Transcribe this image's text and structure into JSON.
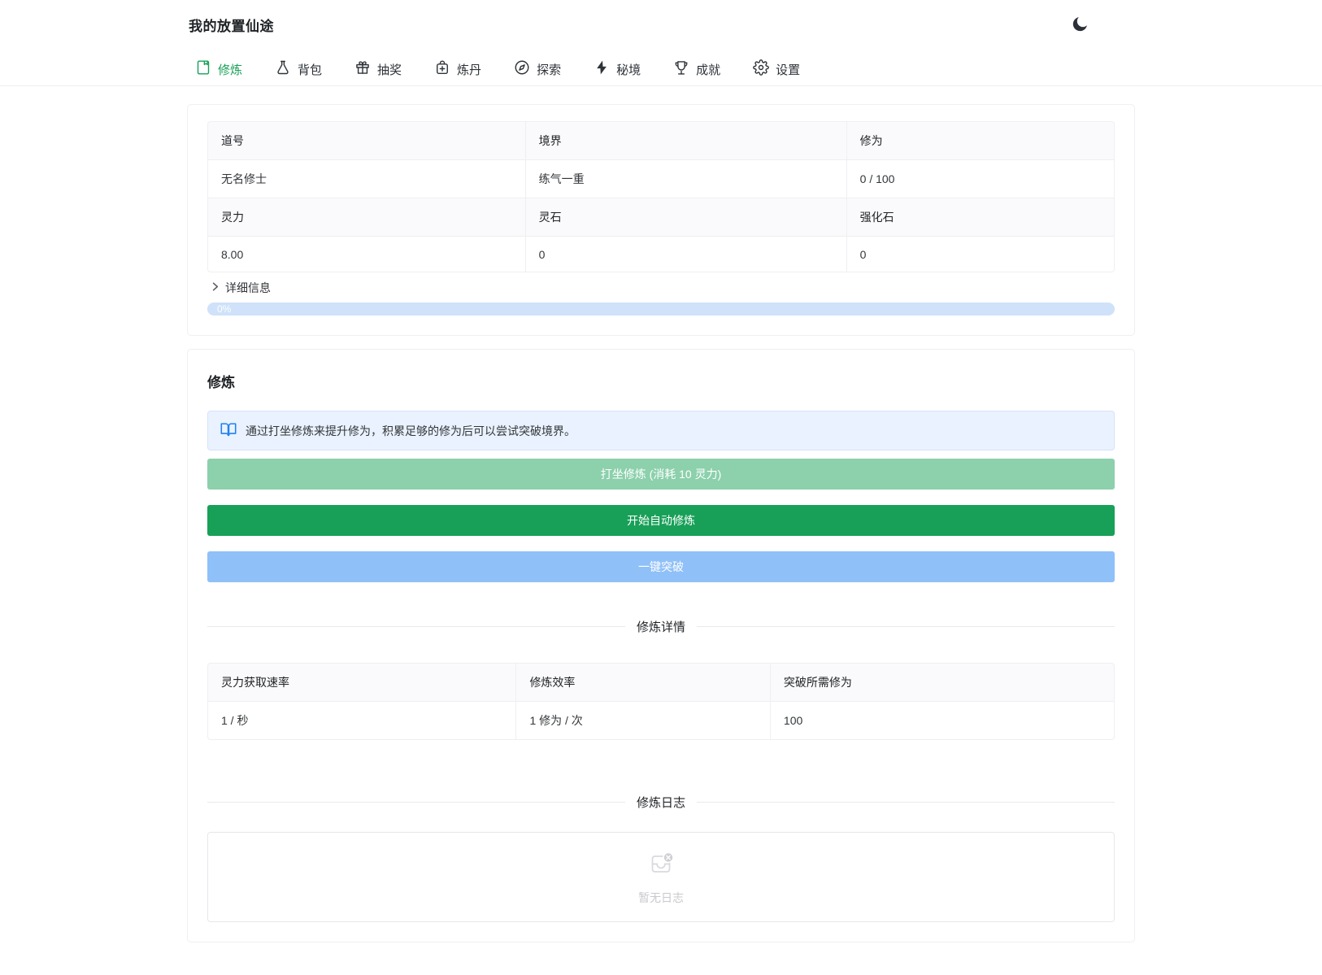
{
  "app": {
    "title": "我的放置仙途"
  },
  "nav": {
    "tabs": [
      {
        "label": "修炼",
        "icon": "journal-icon",
        "active": true
      },
      {
        "label": "背包",
        "icon": "flask-icon",
        "active": false
      },
      {
        "label": "抽奖",
        "icon": "gift-icon",
        "active": false
      },
      {
        "label": "炼丹",
        "icon": "medicine-bag-icon",
        "active": false
      },
      {
        "label": "探索",
        "icon": "compass-icon",
        "active": false
      },
      {
        "label": "秘境",
        "icon": "lightning-icon",
        "active": false
      },
      {
        "label": "成就",
        "icon": "trophy-icon",
        "active": false
      },
      {
        "label": "设置",
        "icon": "gear-icon",
        "active": false
      }
    ],
    "theme_toggle_icon": "moon-icon"
  },
  "stats_card": {
    "table": {
      "rows": [
        {
          "header": true,
          "cells": [
            "道号",
            "境界",
            "修为"
          ]
        },
        {
          "header": false,
          "cells": [
            "无名修士",
            "练气一重",
            "0 / 100"
          ]
        },
        {
          "header": true,
          "cells": [
            "灵力",
            "灵石",
            "强化石"
          ]
        },
        {
          "header": false,
          "cells": [
            "8.00",
            "0",
            "0"
          ]
        }
      ]
    },
    "details_toggle_label": "详细信息",
    "progress": {
      "label": "0%",
      "percent": 0
    }
  },
  "cultivation_card": {
    "title": "修炼",
    "alert_text": "通过打坐修炼来提升修为，积累足够的修为后可以尝试突破境界。",
    "buttons": {
      "meditate": "打坐修炼 (消耗 10 灵力)",
      "auto": "开始自动修炼",
      "breakthrough": "一键突破"
    },
    "details_divider": "修炼详情",
    "details_table": {
      "headers": [
        "灵力获取速率",
        "修炼效率",
        "突破所需修为"
      ],
      "values": [
        "1 / 秒",
        "1 修为 / 次",
        "100"
      ]
    },
    "log_divider": "修炼日志",
    "empty_text": "暂无日志"
  },
  "colors": {
    "accent_green": "#18a058",
    "green_disabled": "#8cd0ac",
    "accent_blue": "#2080f0",
    "blue_disabled": "#90c0f8",
    "progress_rail": "#cfe2fa",
    "alert_bg": "#e9f2fe",
    "table_header_bg": "#fafafc",
    "border": "#efeff5"
  }
}
